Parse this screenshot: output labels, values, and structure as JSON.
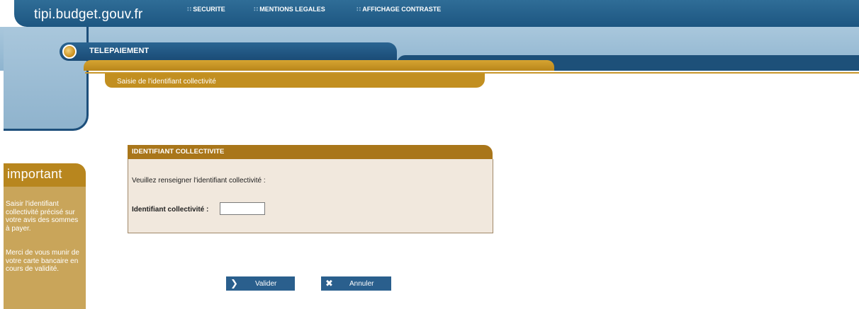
{
  "header": {
    "site_name": "tipi.budget.gouv.fr",
    "nav": [
      {
        "label": "SECURITE"
      },
      {
        "label": "MENTIONS LEGALES"
      },
      {
        "label": "AFFICHAGE CONTRASTE"
      }
    ]
  },
  "section": {
    "title": "TELEPAIEMENT",
    "step": "Saisie de l'identifiant collectivité"
  },
  "important": {
    "title": "important",
    "para1": "Saisir l'identifiant collectivité précisé sur votre avis des sommes à payer.",
    "para2": "Merci de vous munir de votre carte bancaire en cours de validité."
  },
  "form": {
    "title": "IDENTIFIANT COLLECTIVITE",
    "instruction": "Veuillez renseigner l'identifiant collectivité :",
    "field_label": "Identifiant collectivité :",
    "field_value": "",
    "field_placeholder": ""
  },
  "actions": {
    "validate_label": "Valider",
    "cancel_label": "Annuler"
  },
  "colors": {
    "primary_blue": "#1d5681",
    "gold": "#b8861b",
    "form_background": "#f1e8dd"
  },
  "icons": {
    "validate": "chevron-right-icon",
    "cancel": "close-icon"
  }
}
